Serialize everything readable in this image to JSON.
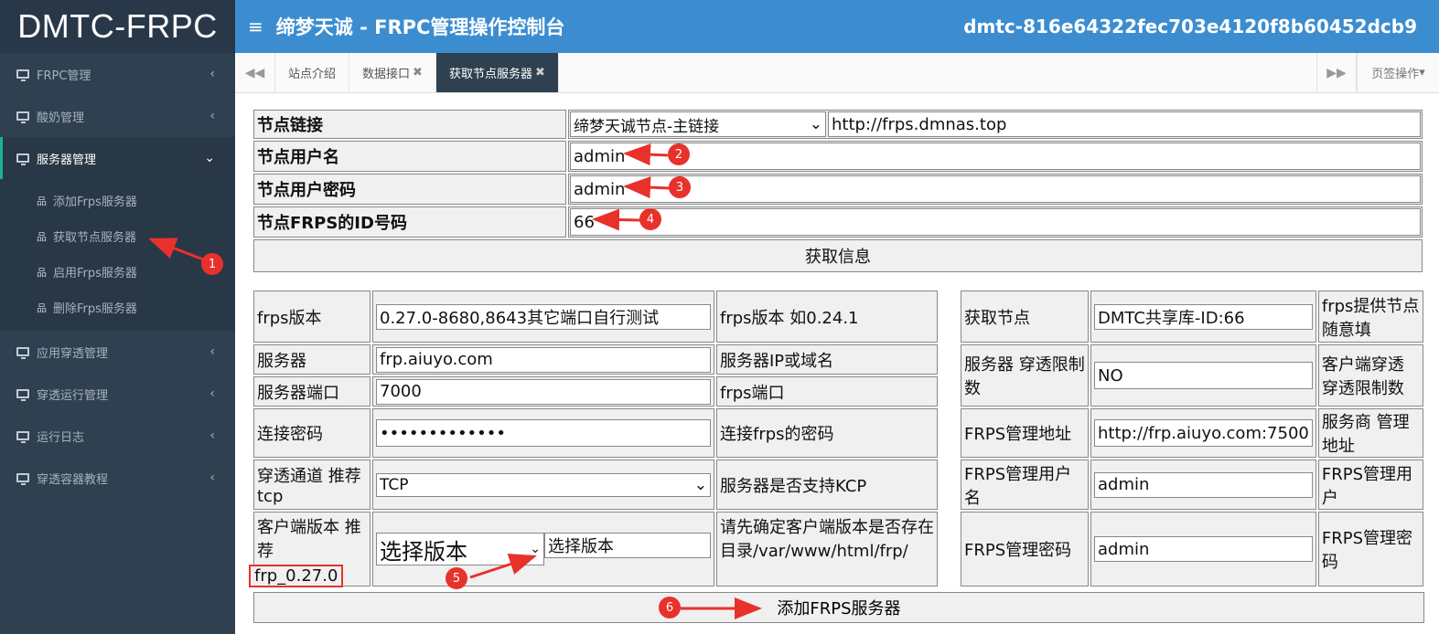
{
  "logo": "DMTC-FRPC",
  "header": {
    "title": "缔梦天诚 - FRPC管理操作控制台",
    "host_id": "dmtc-816e64322fec703e4120f8b60452dcb9"
  },
  "sidebar": {
    "items": [
      {
        "label": "FRPC管理"
      },
      {
        "label": "酸奶管理"
      },
      {
        "label": "服务器管理"
      },
      {
        "label": "应用穿透管理"
      },
      {
        "label": "穿透运行管理"
      },
      {
        "label": "运行日志"
      },
      {
        "label": "穿透容器教程"
      }
    ],
    "sub_items": [
      {
        "label": "添加Frps服务器"
      },
      {
        "label": "获取节点服务器"
      },
      {
        "label": "启用Frps服务器"
      },
      {
        "label": "删除Frps服务器"
      }
    ]
  },
  "tabs": {
    "items": [
      {
        "label": "站点介绍"
      },
      {
        "label": "数据接口"
      },
      {
        "label": "获取节点服务器"
      }
    ],
    "ops_label": "页签操作"
  },
  "node_form": {
    "link_label": "节点链接",
    "link_select": "缔梦天诚节点-主链接",
    "link_url": "http://frps.dmnas.top",
    "user_label": "节点用户名",
    "user_value": "admin",
    "pass_label": "节点用户密码",
    "pass_value": "admin",
    "id_label": "节点FRPS的ID号码",
    "id_value": "66",
    "fetch_button": "获取信息"
  },
  "left_table": {
    "version_label": "frps版本",
    "version_value": "0.27.0-8680,8643其它端口自行测试",
    "version_hint": "frps版本 如0.24.1",
    "server_label": "服务器",
    "server_value": "frp.aiuyo.com",
    "server_hint": "服务器IP或域名",
    "port_label": "服务器端口",
    "port_value": "7000",
    "port_hint": "frps端口",
    "pwd_label": "连接密码",
    "pwd_value": "•••••••••••••",
    "pwd_hint": "连接frps的密码",
    "proto_label": "穿透通道 推荐tcp",
    "proto_value": "TCP",
    "proto_hint": "服务器是否支持KCP",
    "client_label": "客户端版本 推荐",
    "client_recommend": "frp_0.27.0",
    "client_select": "选择版本",
    "client_input": "选择版本",
    "client_hint": "请先确定客户端版本是否存在 目录/var/www/html/frp/"
  },
  "right_table": {
    "node_label": "获取节点",
    "node_value": "DMTC共享库-ID:66",
    "node_hint": "frps提供节点 随意填",
    "limit_label": "服务器 穿透限制数",
    "limit_value": "NO",
    "limit_hint": "客户端穿透 穿透限制数",
    "admin_url_label": "FRPS管理地址",
    "admin_url_value": "http://frp.aiuyo.com:7500",
    "admin_url_hint": "服务商 管理地址",
    "admin_user_label": "FRPS管理用户名",
    "admin_user_value": "admin",
    "admin_user_hint": "FRPS管理用户",
    "admin_pwd_label": "FRPS管理密码",
    "admin_pwd_value": "admin",
    "admin_pwd_hint": "FRPS管理密码"
  },
  "add_button": "添加FRPS服务器",
  "annotations": [
    "1",
    "2",
    "3",
    "4",
    "5",
    "6"
  ],
  "colors": {
    "sidebar": "#2f4050",
    "header": "#3c8dd0",
    "annotation": "#e8312b",
    "highlight_box": "#e8312b"
  }
}
